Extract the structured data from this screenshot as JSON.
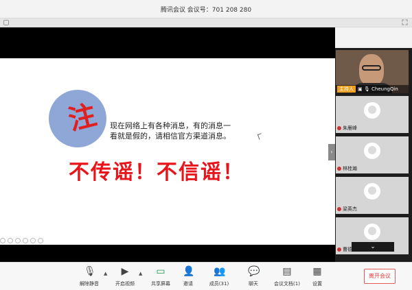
{
  "window": {
    "title": "腾讯会议 会议号：701 208 280"
  },
  "slide": {
    "badge_char": "注",
    "message_line1": "现在网络上有各种消息，有的消息一",
    "message_line2": "看就是假的，请相信官方渠道消息。",
    "slogan": "不传谣！不信谣！"
  },
  "participants": {
    "host": {
      "tag": "主持人",
      "name": "CheungQin"
    },
    "others": [
      {
        "name": "朱雁峰"
      },
      {
        "name": "林桂瀚"
      },
      {
        "name": "梁英杰"
      },
      {
        "name": "曹德龙"
      }
    ]
  },
  "toolbar": {
    "mute": "解除静音",
    "video": "开启视频",
    "share": "共享屏幕",
    "invite": "邀请",
    "members": "成员(31)",
    "chat": "聊天",
    "docs": "会议文档(1)",
    "settings": "设置",
    "end": "离开会议"
  },
  "colors": {
    "slogan": "#e8141a",
    "badge": "#8fa7d6",
    "end_button": "#e23b3b",
    "host_tag": "#f0a020"
  }
}
